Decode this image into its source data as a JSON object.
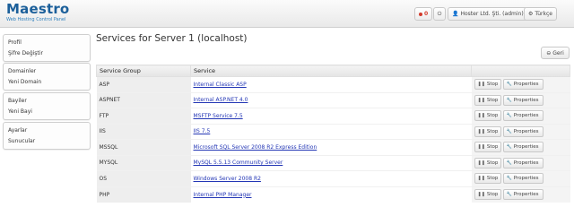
{
  "brand": {
    "title": "Maestro",
    "subtitle": "Web Hosting Control Panel"
  },
  "header": {
    "notifications_count": "0",
    "power_icon": "power-icon",
    "user_label": "Hoster Ltd. Şti. (admin)",
    "language_label": "Türkçe"
  },
  "sidebar": {
    "groups": [
      {
        "items": [
          "Profil",
          "Şifre Değiştir"
        ]
      },
      {
        "items": [
          "Domainler",
          "Yeni Domain"
        ]
      },
      {
        "items": [
          "Bayiler",
          "Yeni Bayi"
        ]
      },
      {
        "items": [
          "Ayarlar",
          "Sunucular"
        ]
      }
    ]
  },
  "main": {
    "title": "Services for Server 1 (localhost)",
    "back_label": "Geri",
    "columns": [
      "Service Group",
      "Service",
      ""
    ],
    "stop_label": "Stop",
    "properties_label": "Properties",
    "rows": [
      {
        "group": "ASP",
        "service": "Internal Classic ASP"
      },
      {
        "group": "ASPNET",
        "service": "Internal ASP.NET 4.0"
      },
      {
        "group": "FTP",
        "service": "MSFTP Service 7.5"
      },
      {
        "group": "IIS",
        "service": "IIS 7.5"
      },
      {
        "group": "MSSQL",
        "service": "Microsoft SQL Server 2008 R2 Express Edition"
      },
      {
        "group": "MYSQL",
        "service": "MySQL 5.5.13 Community Server"
      },
      {
        "group": "OS",
        "service": "Windows Server 2008 R2"
      },
      {
        "group": "PHP",
        "service": "Internal PHP Manager"
      }
    ]
  }
}
